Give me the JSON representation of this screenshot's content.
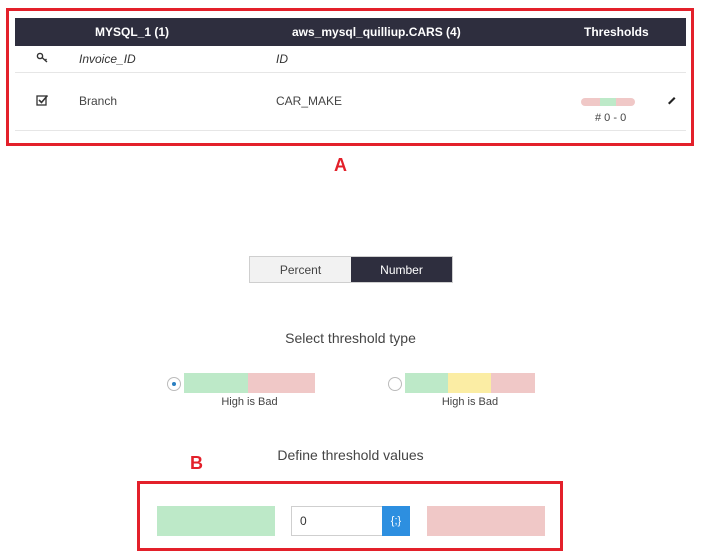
{
  "annotations": {
    "a": "A",
    "b": "B"
  },
  "table": {
    "header": {
      "col1": "MYSQL_1 (1)",
      "col2": "aws_mysql_quilliup.CARS (4)",
      "col3": "Thresholds"
    },
    "subheader": {
      "col1": "Invoice_ID",
      "col2": "ID"
    },
    "row": {
      "col1": "Branch",
      "col2": "CAR_MAKE",
      "threshold_text": "# 0 - 0"
    }
  },
  "mode_toggle": {
    "percent": "Percent",
    "number": "Number",
    "selected": "Number"
  },
  "threshold_type": {
    "heading": "Select threshold type",
    "options": [
      {
        "caption": "High is Bad",
        "selected": true
      },
      {
        "caption": "High is Bad",
        "selected": false
      }
    ]
  },
  "threshold_values": {
    "heading": "Define threshold values",
    "value": "0",
    "variable_button": "{;}"
  },
  "colors": {
    "green": "#bde9c8",
    "red": "#f0c8c7",
    "yellow": "#fbeda4",
    "header": "#2e2e3e",
    "accent": "#2d8fe0",
    "annotation": "#e3202a"
  }
}
